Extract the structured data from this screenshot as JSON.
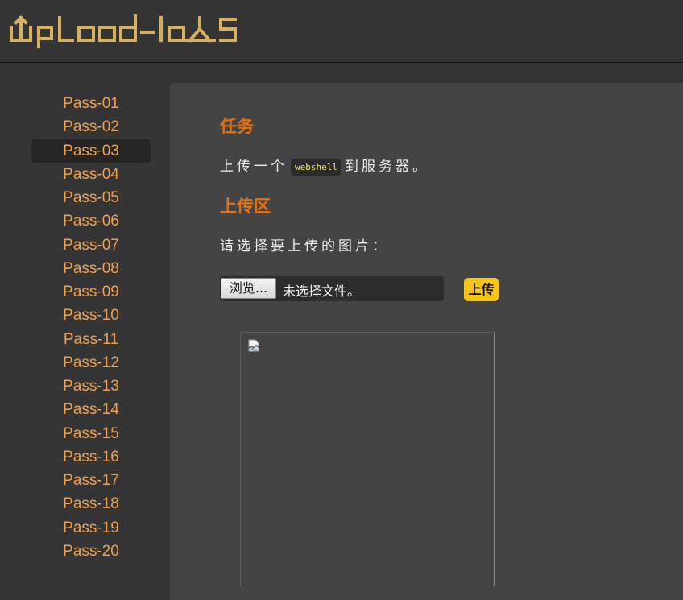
{
  "header": {
    "logo_text": "UpLoad-labs"
  },
  "sidebar": {
    "items": [
      {
        "label": "Pass-01"
      },
      {
        "label": "Pass-02"
      },
      {
        "label": "Pass-03"
      },
      {
        "label": "Pass-04"
      },
      {
        "label": "Pass-05"
      },
      {
        "label": "Pass-06"
      },
      {
        "label": "Pass-07"
      },
      {
        "label": "Pass-08"
      },
      {
        "label": "Pass-09"
      },
      {
        "label": "Pass-10"
      },
      {
        "label": "Pass-11"
      },
      {
        "label": "Pass-12"
      },
      {
        "label": "Pass-13"
      },
      {
        "label": "Pass-14"
      },
      {
        "label": "Pass-15"
      },
      {
        "label": "Pass-16"
      },
      {
        "label": "Pass-17"
      },
      {
        "label": "Pass-18"
      },
      {
        "label": "Pass-19"
      },
      {
        "label": "Pass-20"
      }
    ],
    "active_label": "Pass-03"
  },
  "main": {
    "task_heading": "任务",
    "task_text_before": "上传一个",
    "task_code": "webshell",
    "task_text_after": "到服务器。",
    "upload_heading": "上传区",
    "upload_prompt": "请选择要上传的图片：",
    "browse_label": "浏览...",
    "file_status": "未选择文件。",
    "upload_button": "上传",
    "preview_icon": "broken-image-icon"
  },
  "colors": {
    "accent": "#e8700f",
    "sidebar_link": "#f0a050",
    "button": "#f5c518",
    "code_text": "#f5e66b",
    "logo": "#d8b060"
  }
}
